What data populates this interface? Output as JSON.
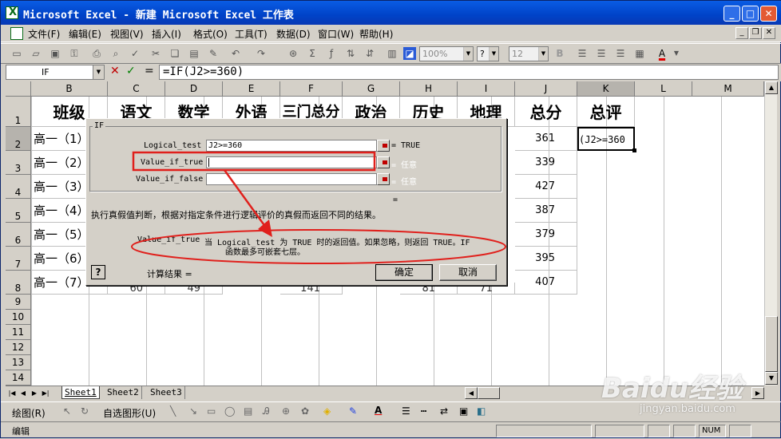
{
  "window": {
    "title": "Microsoft Excel - 新建 Microsoft Excel 工作表"
  },
  "menu": [
    "文件(F)",
    "编辑(E)",
    "视图(V)",
    "插入(I)",
    "格式(O)",
    "工具(T)",
    "数据(D)",
    "窗口(W)",
    "帮助(H)"
  ],
  "toolbar": {
    "zoom": "100%",
    "help_combo": "?",
    "font_size": "12",
    "bold": "B",
    "font_color_icon": "A"
  },
  "formula_bar": {
    "name_box": "IF",
    "cancel": "✕",
    "enter": "✓",
    "equals": "=",
    "formula": "=IF(J2>=360)"
  },
  "grid": {
    "columns": [
      "B",
      "C",
      "D",
      "E",
      "F",
      "G",
      "H",
      "I",
      "J",
      "K",
      "L",
      "M"
    ],
    "rows": [
      "1",
      "2",
      "3",
      "4",
      "5",
      "6",
      "7",
      "8",
      "9",
      "10",
      "11",
      "12",
      "13",
      "14"
    ],
    "headers": [
      "班级",
      "语文",
      "数学",
      "外语",
      "三门总分",
      "政治",
      "历史",
      "地理",
      "总分",
      "总评"
    ],
    "class_names": [
      "高一（1）",
      "高一（2）",
      "高一（3）",
      "高一（4）",
      "高一（5）",
      "高一（6）",
      "高一（7）"
    ],
    "row8_partial": [
      "60",
      "49",
      "141",
      "81",
      "71"
    ],
    "totals": [
      "361",
      "339",
      "427",
      "387",
      "379",
      "395",
      "407"
    ],
    "k2_value": "J2>=360)"
  },
  "dialog": {
    "group_title": "IF",
    "args": [
      {
        "label": "Logical_test",
        "value": "J2>=360",
        "result": "= TRUE"
      },
      {
        "label": "Value_if_true",
        "value": "",
        "result": "= 任意"
      },
      {
        "label": "Value_if_false",
        "value": "",
        "result": "= 任意"
      }
    ],
    "equals_line": "=",
    "description": "执行真假值判断，根据对指定条件进行逻辑评价的真假而返回不同的结果。",
    "arg_help_name": "Value_if_true",
    "arg_help_line1": "当 Logical_test 为 TRUE 时的返回值。如果忽略，则返回 TRUE。IF",
    "arg_help_line2": "函数最多可嵌套七层。",
    "help_icon": "?",
    "calc_label": "计算结果 =",
    "ok_label": "确定",
    "cancel_label": "取消"
  },
  "sheets": [
    "Sheet1",
    "Sheet2",
    "Sheet3"
  ],
  "drawing": {
    "draw_label": "绘图(R)",
    "autoshape_label": "自选图形(U)"
  },
  "status": {
    "mode": "编辑",
    "num": "NUM"
  },
  "watermark": {
    "brand": "Baidu经验",
    "url": "jingyan.baidu.com"
  },
  "colors": {
    "annotation_red": "#e0201c",
    "title_blue": "#0a5ce4"
  }
}
